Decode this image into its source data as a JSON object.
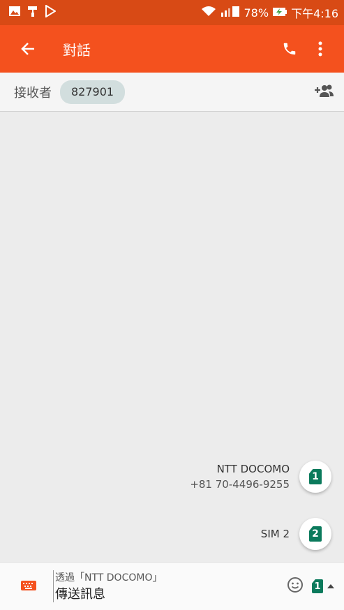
{
  "status_bar": {
    "battery": "78%",
    "time": "下午4:16"
  },
  "app_bar": {
    "title": "對話"
  },
  "recipient": {
    "label": "接收者",
    "chip": "827901"
  },
  "sim_options": [
    {
      "name": "NTT DOCOMO",
      "number": "+81 70-4496-9255",
      "badge": "1"
    },
    {
      "name": "SIM 2",
      "badge": "2"
    }
  ],
  "composer": {
    "hint": "透過「NTT DOCOMO」",
    "placeholder": "傳送訊息",
    "sim_badge": "1"
  },
  "colors": {
    "accent": "#f4511e",
    "status_bar": "#d84a15",
    "sim_green": "#0b7a5c"
  }
}
